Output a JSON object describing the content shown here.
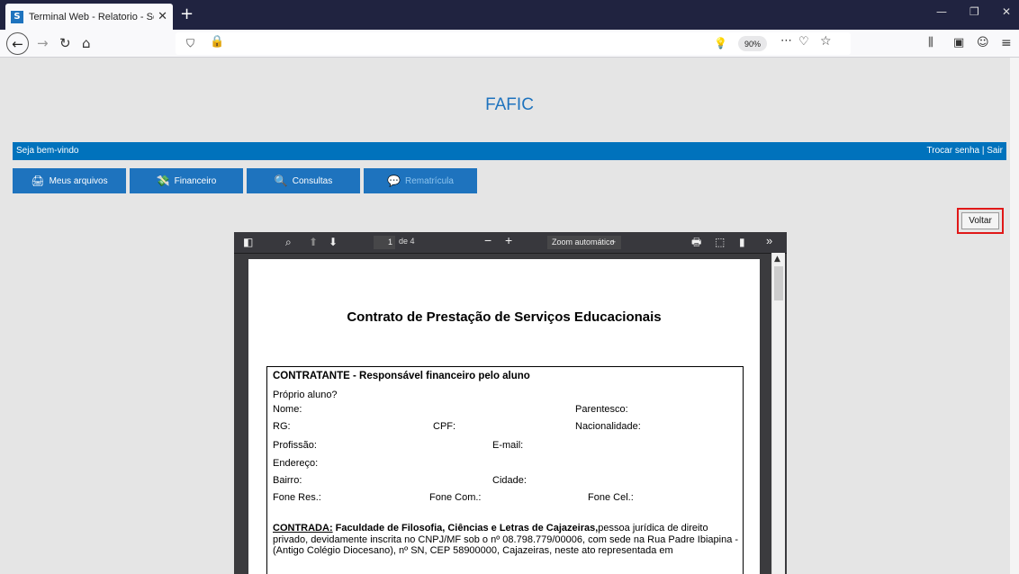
{
  "browser": {
    "tab_title": "Terminal Web - Relatorio - Sop",
    "favicon_letter": "S",
    "zoom": "90%"
  },
  "site": {
    "title": "FAFIC",
    "welcome": "Seja bem-vindo",
    "account_links": "Trocar senha | Sair",
    "menu": [
      {
        "label": "Meus arquivos",
        "icon": "printer-icon"
      },
      {
        "label": "Financeiro",
        "icon": "money-icon"
      },
      {
        "label": "Consultas",
        "icon": "search-icon"
      },
      {
        "label": "Rematrícula",
        "icon": "chat-icon",
        "active": true
      }
    ],
    "back_button": "Voltar"
  },
  "pdf": {
    "page_current": "1",
    "page_total": "de 4",
    "zoom": "Zoom automático",
    "zoom_arrow": "÷",
    "document": {
      "title": "Contrato de Prestação de Serviços Educacionais",
      "section_header": "CONTRATANTE - Responsável financeiro pelo aluno",
      "fields": {
        "proprio_aluno": "Próprio aluno?",
        "nome": "Nome:",
        "parentesco": "Parentesco:",
        "rg": "RG:",
        "cpf": "CPF:",
        "nacionalidade": "Nacionalidade:",
        "profissao": "Profissão:",
        "email": "E-mail:",
        "endereco": "Endereço:",
        "bairro": "Bairro:",
        "cidade": "Cidade:",
        "fone_res": "Fone Res.:",
        "fone_com": "Fone Com.:",
        "fone_cel": "Fone Cel.:"
      },
      "contratada_label": "CONTRADA:",
      "contratada_name": "Faculdade de Filosofia, Ciências e Letras de Cajazeiras,",
      "contratada_text": "pessoa jurídica de direito privado, devidamente inscrita no CNPJ/MF sob o nº 08.798.779/00006, com sede na Rua Padre Ibiapina - (Antigo Colégio Diocesano), nº SN, CEP 58900000, Cajazeiras, neste ato representada em"
    }
  }
}
